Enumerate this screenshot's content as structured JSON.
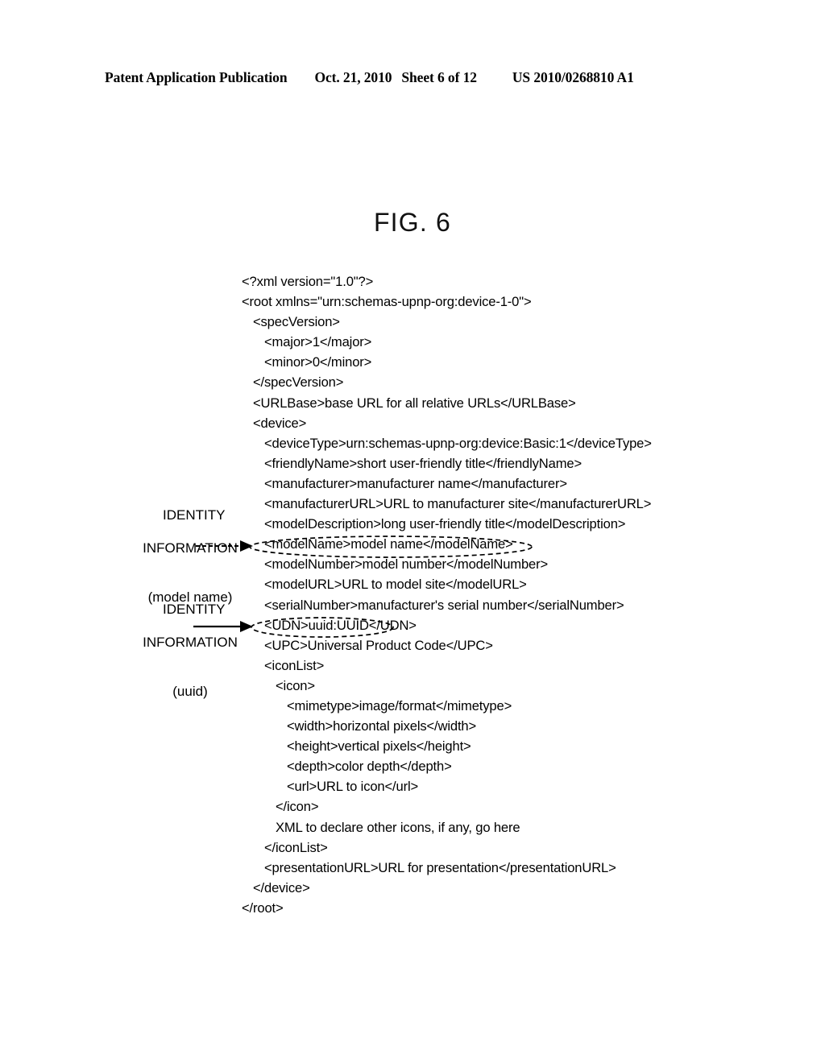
{
  "header": {
    "publication": "Patent Application Publication",
    "date": "Oct. 21, 2010",
    "sheet": "Sheet 6 of 12",
    "patent_number": "US 2010/0268810 A1"
  },
  "figure": {
    "title": "FIG. 6"
  },
  "xml_listing": {
    "lines": [
      {
        "indent": 0,
        "text": "<?xml version=\"1.0\"?>"
      },
      {
        "indent": 0,
        "text": "<root xmlns=\"urn:schemas-upnp-org:device-1-0\">"
      },
      {
        "indent": 1,
        "text": "<specVersion>"
      },
      {
        "indent": 2,
        "text": "<major>1</major>"
      },
      {
        "indent": 2,
        "text": "<minor>0</minor>"
      },
      {
        "indent": 1,
        "text": "</specVersion>"
      },
      {
        "indent": 1,
        "text": "<URLBase>base URL for all relative URLs</URLBase>"
      },
      {
        "indent": 1,
        "text": "<device>"
      },
      {
        "indent": 2,
        "text": "<deviceType>urn:schemas-upnp-org:device:Basic:1</deviceType>"
      },
      {
        "indent": 2,
        "text": "<friendlyName>short user-friendly title</friendlyName>"
      },
      {
        "indent": 2,
        "text": "<manufacturer>manufacturer name</manufacturer>"
      },
      {
        "indent": 2,
        "text": "<manufacturerURL>URL to manufacturer site</manufacturerURL>"
      },
      {
        "indent": 2,
        "text": "<modelDescription>long user-friendly title</modelDescription>"
      },
      {
        "indent": 2,
        "text": "<modelName>model name</modelName>",
        "annotated": true
      },
      {
        "indent": 2,
        "text": "<modelNumber>model number</modelNumber>"
      },
      {
        "indent": 2,
        "text": "<modelURL>URL to model site</modelURL>"
      },
      {
        "indent": 2,
        "text": "<serialNumber>manufacturer's serial number</serialNumber>"
      },
      {
        "indent": 2,
        "text": "<UDN>uuid:UUID</UDN>",
        "annotated": true
      },
      {
        "indent": 2,
        "text": "<UPC>Universal Product Code</UPC>"
      },
      {
        "indent": 2,
        "text": "<iconList>"
      },
      {
        "indent": 3,
        "text": "<icon>"
      },
      {
        "indent": 4,
        "text": "<mimetype>image/format</mimetype>"
      },
      {
        "indent": 4,
        "text": "<width>horizontal pixels</width>"
      },
      {
        "indent": 4,
        "text": "<height>vertical pixels</height>"
      },
      {
        "indent": 4,
        "text": "<depth>color depth</depth>"
      },
      {
        "indent": 4,
        "text": "<url>URL to icon</url>"
      },
      {
        "indent": 3,
        "text": "</icon>"
      },
      {
        "indent": 3,
        "text": "XML to declare other icons, if any, go here"
      },
      {
        "indent": 2,
        "text": "</iconList>"
      },
      {
        "indent": 2,
        "text": "<presentationURL>URL for presentation</presentationURL>"
      },
      {
        "indent": 1,
        "text": "</device>"
      },
      {
        "indent": 0,
        "text": "</root>"
      }
    ]
  },
  "annotations": [
    {
      "id": "model-name",
      "line1": "IDENTITY",
      "line2": "INFORMATION",
      "line3": "(model name)",
      "arrow_style": "dashed",
      "target_line_index": 13
    },
    {
      "id": "uuid",
      "line1": "IDENTITY",
      "line2": "INFORMATION",
      "line3": "(uuid)",
      "arrow_style": "solid",
      "target_line_index": 17
    }
  ],
  "colors": {
    "ink": "#000000",
    "background": "#ffffff"
  }
}
